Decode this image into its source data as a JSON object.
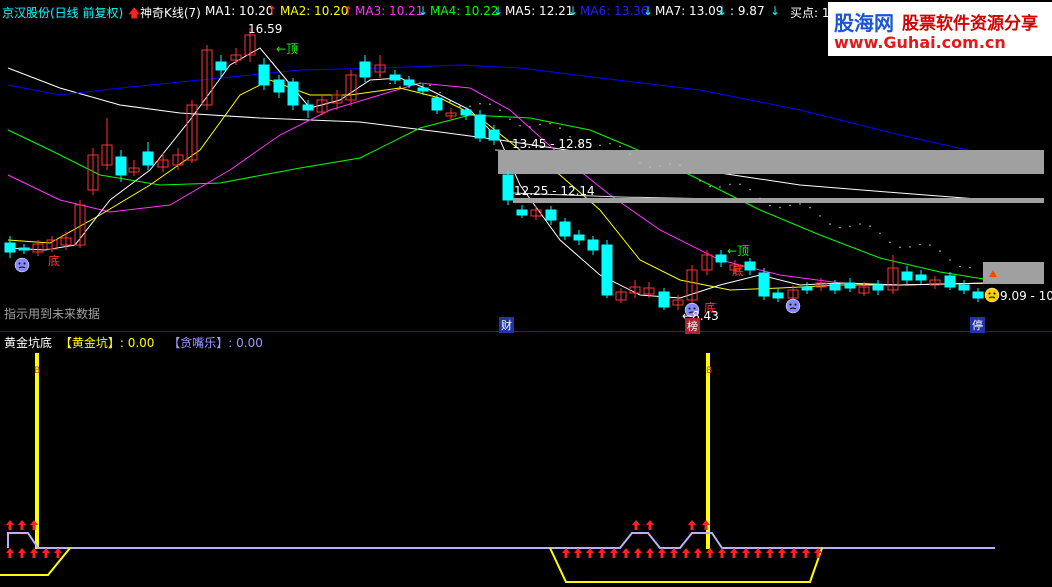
{
  "header": {
    "stock_title": "京汉股份(日线 前复权)",
    "indicator_name": "神奇K线(7)",
    "ma1": "MA1: 10.20",
    "ma2": "MA2: 10.20",
    "ma3": "MA3: 10.21",
    "ma4": "MA4: 10.22",
    "ma5": "MA5: 12.21",
    "ma6": "MA6: 13.36",
    "ma7": "MA7: 13.09",
    "extra_value": ": 9.87",
    "buy_point": "买点: 1"
  },
  "colors": {
    "ma1": "#ffffff",
    "ma2": "#ffff00",
    "ma3": "#ff33ff",
    "ma4": "#00ff00",
    "ma5": "#ffffff",
    "ma6": "#0000ff",
    "ma7": "#ffffff",
    "up": "#ff3333",
    "down": "#00ffff",
    "title": "#00ffff"
  },
  "logo": {
    "brand": "股海网",
    "slogan": "股票软件资源分享",
    "url": "www.Guhai.com.cn"
  },
  "annotations": {
    "high_price": "16.59",
    "top_label_1": "顶",
    "top_label_2": "顶",
    "bottom_label_1": "底",
    "bottom_label_2": "底",
    "bottom_label_3": "底",
    "low_price": "8.43",
    "zone_upper": "13.45 - 12.85",
    "zone_lower": "12.25 - 12.14",
    "zone_right": "9.09 - 10.",
    "hint_text": "指示用到未来数据",
    "badge_cai": "财",
    "badge_bang": "榜",
    "badge_ting": "停"
  },
  "sub_indicator": {
    "name": "黄金坑底",
    "series1_label": "【黄金坑】",
    "series1_value": ": 0.00",
    "series2_label": "【贪嘴乐】",
    "series2_value": ": 0.00",
    "signal_char": "B"
  }
}
